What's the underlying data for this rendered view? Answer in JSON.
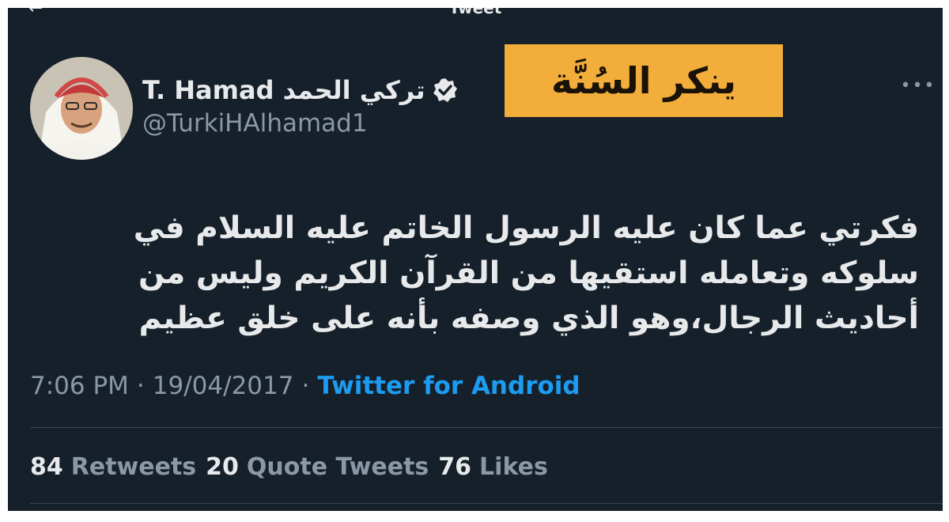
{
  "header": {
    "title": "Tweet",
    "back_icon": "arrow-left-icon"
  },
  "author": {
    "display_name": "T. Hamad تركي الحمد",
    "handle": "@TurkiHAlhamad1",
    "verified_icon": "verified-badge-icon"
  },
  "overlay_label": "ينكر السُنَّة",
  "more_icon": "more-horizontal-icon",
  "tweet": {
    "text": "فكرتي عما كان عليه الرسول الخاتم عليه السلام في سلوكه وتعامله استقيها من القرآن الكريم وليس من أحاديث الرجال،وهو الذي وصفه بأنه على خلق عظيم",
    "time": "7:06 PM",
    "separator": "·",
    "date": "19/04/2017",
    "source": "Twitter for Android"
  },
  "stats": {
    "retweets_count": "84",
    "retweets_label": "Retweets",
    "quotes_count": "20",
    "quotes_label": "Quote Tweets",
    "likes_count": "76",
    "likes_label": "Likes"
  },
  "colors": {
    "background": "#15202b",
    "text_primary": "#e7e9ea",
    "text_secondary": "#8b98a5",
    "link": "#1d9bf0",
    "banner": "#f2ad3a"
  }
}
